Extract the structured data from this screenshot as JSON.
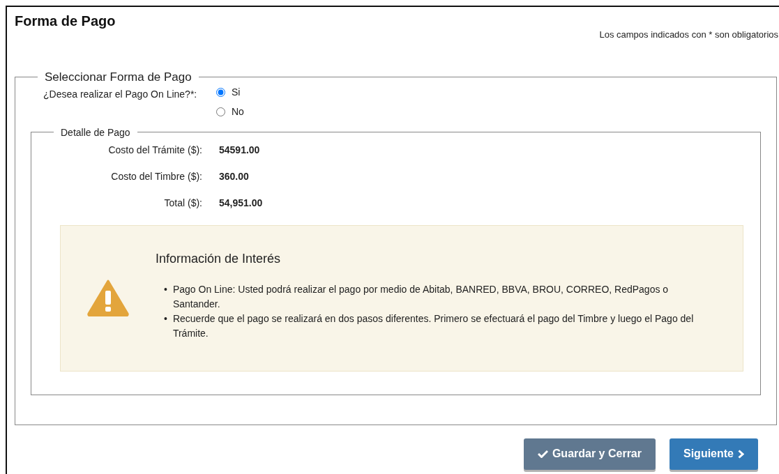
{
  "title": "Forma de Pago",
  "required_note": "Los campos indicados con * son obligatorios",
  "payment_section": {
    "legend": "Seleccionar Forma de Pago",
    "question": "¿Desea realizar el Pago On Line?*:",
    "options": [
      {
        "label": "Si",
        "selected": true
      },
      {
        "label": "No",
        "selected": false
      }
    ]
  },
  "detail_section": {
    "legend": "Detalle de Pago",
    "rows": [
      {
        "label": "Costo del Trámite ($):",
        "value": "54591.00"
      },
      {
        "label": "Costo del Timbre ($):",
        "value": "360.00"
      },
      {
        "label": "Total ($):",
        "value": "54,951.00"
      }
    ]
  },
  "info_box": {
    "title": "Información de Interés",
    "items": [
      {
        "bullet": "•",
        "text": "Pago On Line: Usted podrá realizar el pago por medio de Abitab, BANRED, BBVA, BROU, CORREO, RedPagos o Santander."
      },
      {
        "bullet": "•",
        "text": "Recuerde que el pago se realizará en dos pasos diferentes. Primero se efectuará el pago del Timbre y luego el Pago del Trámite."
      }
    ]
  },
  "buttons": [
    {
      "label": "Guardar y Cerrar",
      "kind": "save"
    },
    {
      "label": "Siguiente",
      "kind": "next"
    }
  ]
}
